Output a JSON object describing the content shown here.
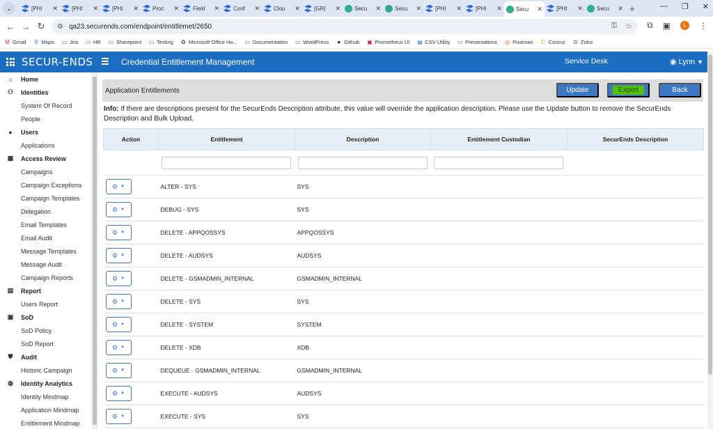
{
  "browser": {
    "tabs": [
      {
        "label": "[PHI",
        "icon": "confluence"
      },
      {
        "label": "[PHI",
        "icon": "confluence"
      },
      {
        "label": "[PHI",
        "icon": "confluence"
      },
      {
        "label": "Proc",
        "icon": "confluence"
      },
      {
        "label": "Field",
        "icon": "confluence"
      },
      {
        "label": "Conf",
        "icon": "confluence"
      },
      {
        "label": "Clou",
        "icon": "confluence"
      },
      {
        "label": "[GR(",
        "icon": "confluence"
      },
      {
        "label": "Secu",
        "icon": "securends"
      },
      {
        "label": "Secu",
        "icon": "securends"
      },
      {
        "label": "[PHI",
        "icon": "confluence"
      },
      {
        "label": "[PHI",
        "icon": "confluence"
      },
      {
        "label": "Secu",
        "icon": "securends",
        "active": true
      },
      {
        "label": "[PHI",
        "icon": "confluence"
      },
      {
        "label": "Secu",
        "icon": "securends"
      }
    ],
    "url": "qa23.securends.com/endpoint/entitlemet/2650",
    "profile_initial": "L",
    "bookmarks": [
      {
        "label": "Gmail",
        "icon": "gmail-icon"
      },
      {
        "label": "Maps",
        "icon": "maps-icon"
      },
      {
        "label": "Jira",
        "icon": "folder-icon"
      },
      {
        "label": "HR",
        "icon": "folder-icon"
      },
      {
        "label": "Sharepoint",
        "icon": "folder-icon"
      },
      {
        "label": "Testing",
        "icon": "folder-icon"
      },
      {
        "label": "Microsoft Office Ho...",
        "icon": "office-icon"
      },
      {
        "label": "Documentation",
        "icon": "folder-icon"
      },
      {
        "label": "WordPress",
        "icon": "folder-icon"
      },
      {
        "label": "Github",
        "icon": "github-icon"
      },
      {
        "label": "Prometheus UI",
        "icon": "prometheus-icon"
      },
      {
        "label": "CSV Utility",
        "icon": "csv-icon"
      },
      {
        "label": "Presentations",
        "icon": "folder-icon"
      },
      {
        "label": "Postman",
        "icon": "postman-icon"
      },
      {
        "label": "Concur",
        "icon": "concur-icon"
      },
      {
        "label": "Zoho",
        "icon": "zoho-icon"
      }
    ]
  },
  "header": {
    "logo": "SECUR-ENDS",
    "title": "Credential Entitlement Management",
    "service_desk": "Service Desk",
    "user": "Lynn"
  },
  "sidebar": {
    "items": [
      {
        "label": "Home",
        "type": "sec",
        "icon": "home-icon"
      },
      {
        "label": "Identities",
        "type": "sec",
        "icon": "users-group-icon"
      },
      {
        "label": "System Of Record",
        "type": "sub"
      },
      {
        "label": "People",
        "type": "sub"
      },
      {
        "label": "Users",
        "type": "sec",
        "icon": "user-icon"
      },
      {
        "label": "Applications",
        "type": "sub"
      },
      {
        "label": "Access Review",
        "type": "sec",
        "icon": "grid-icon"
      },
      {
        "label": "Campaigns",
        "type": "sub"
      },
      {
        "label": "Campaign Exceptions",
        "type": "sub"
      },
      {
        "label": "Campaign Templates",
        "type": "sub"
      },
      {
        "label": "Delegation",
        "type": "sub"
      },
      {
        "label": "Email Templates",
        "type": "sub"
      },
      {
        "label": "Email Audit",
        "type": "sub"
      },
      {
        "label": "Message Templates",
        "type": "sub"
      },
      {
        "label": "Message Audit",
        "type": "sub"
      },
      {
        "label": "Campaign Reports",
        "type": "sub"
      },
      {
        "label": "Report",
        "type": "sec",
        "icon": "report-icon"
      },
      {
        "label": "Users Report",
        "type": "sub"
      },
      {
        "label": "SoD",
        "type": "sec",
        "icon": "sod-icon"
      },
      {
        "label": "SoD Policy",
        "type": "sub"
      },
      {
        "label": "SoD Report",
        "type": "sub"
      },
      {
        "label": "Audit",
        "type": "sec",
        "icon": "shield-icon"
      },
      {
        "label": "Historic Campaign",
        "type": "sub"
      },
      {
        "label": "Identity Analytics",
        "type": "sec",
        "icon": "analytics-icon"
      },
      {
        "label": "Identity Mindmap",
        "type": "sub"
      },
      {
        "label": "Application Mindmap",
        "type": "sub"
      },
      {
        "label": "Entitlement Mindmap",
        "type": "sub"
      }
    ]
  },
  "panel": {
    "title": "Application Entitlements",
    "update_label": "Update",
    "export_label": "Export",
    "back_label": "Back"
  },
  "info": {
    "label": "Info:",
    "text": "If there are descriptions present for the SecurEnds Description attribute, this value will override the application description. Please use the Update button to remove the SecurEnds Description and Bulk Upload."
  },
  "table": {
    "columns": [
      "Action",
      "Entitlement",
      "Description",
      "Entitlement Custodian",
      "SecurEnds Description"
    ],
    "rows": [
      {
        "entitlement": "ALTER - SYS",
        "description": "SYS"
      },
      {
        "entitlement": "DEBUG - SYS",
        "description": "SYS"
      },
      {
        "entitlement": "DELETE - APPQOSSYS",
        "description": "APPQOSSYS"
      },
      {
        "entitlement": "DELETE - AUDSYS",
        "description": "AUDSYS"
      },
      {
        "entitlement": "DELETE - GSMADMIN_INTERNAL",
        "description": "GSMADMIN_INTERNAL"
      },
      {
        "entitlement": "DELETE - SYS",
        "description": "SYS"
      },
      {
        "entitlement": "DELETE - SYSTEM",
        "description": "SYSTEM"
      },
      {
        "entitlement": "DELETE - XDB",
        "description": "XDB"
      },
      {
        "entitlement": "DEQUEUE - GSMADMIN_INTERNAL",
        "description": "GSMADMIN_INTERNAL"
      },
      {
        "entitlement": "EXECUTE - AUDSYS",
        "description": "AUDSYS"
      },
      {
        "entitlement": "EXECUTE - SYS",
        "description": "SYS"
      }
    ]
  },
  "colors": {
    "header_bg": "#1b6ec2",
    "button_bg": "#3c78c3",
    "export_highlight": "#59c200",
    "table_header_bg": "#e6eef8"
  }
}
